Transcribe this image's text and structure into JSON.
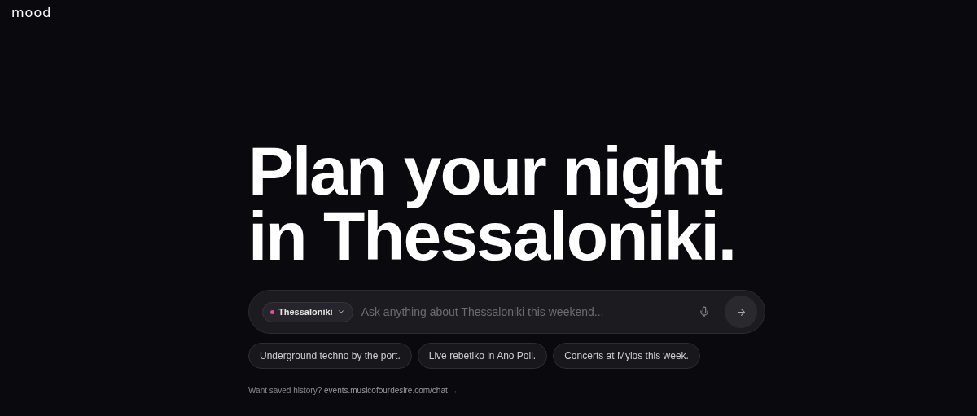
{
  "logo": "mood",
  "headline": [
    "Plan your night",
    "in Thessaloniki."
  ],
  "search": {
    "location": {
      "label": "Thessaloniki",
      "color": "#e0509a"
    },
    "placeholder": "Ask anything about Thessaloniki this weekend..."
  },
  "suggestions": [
    "Underground techno by the port.",
    "Live rebetiko in Ano Poli.",
    "Concerts at Mylos this week."
  ],
  "footer": {
    "text": "Want saved history?",
    "link": "events.musicofourdesire.com/chat →"
  }
}
